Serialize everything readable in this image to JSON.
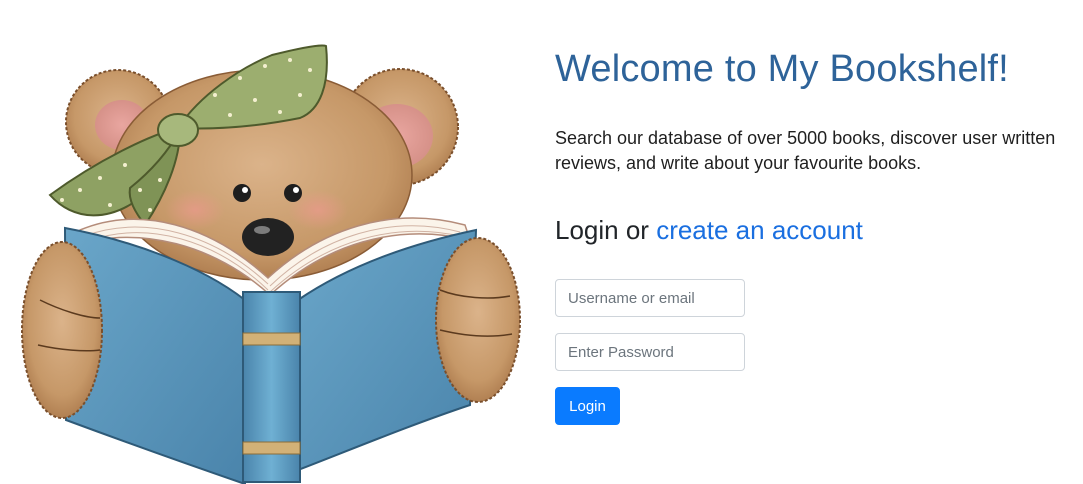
{
  "page": {
    "title": "Welcome to My Bookshelf!",
    "intro": "Search our database of over 5000 books, discover user written reviews, and write about your favourite books."
  },
  "login": {
    "heading_prefix": "Login or ",
    "create_account_link": "create an account",
    "username_placeholder": "Username or email",
    "password_placeholder": "Enter Password",
    "submit_label": "Login"
  },
  "colors": {
    "title": "#2e6399",
    "link": "#1a6fe0",
    "button": "#0a7bff",
    "book_cover": "#5a93b8",
    "bear_fur": "#c08f62",
    "bow": "#8ea163"
  },
  "illustration": {
    "icon": "teddy-bear-reading-book-illustration"
  }
}
